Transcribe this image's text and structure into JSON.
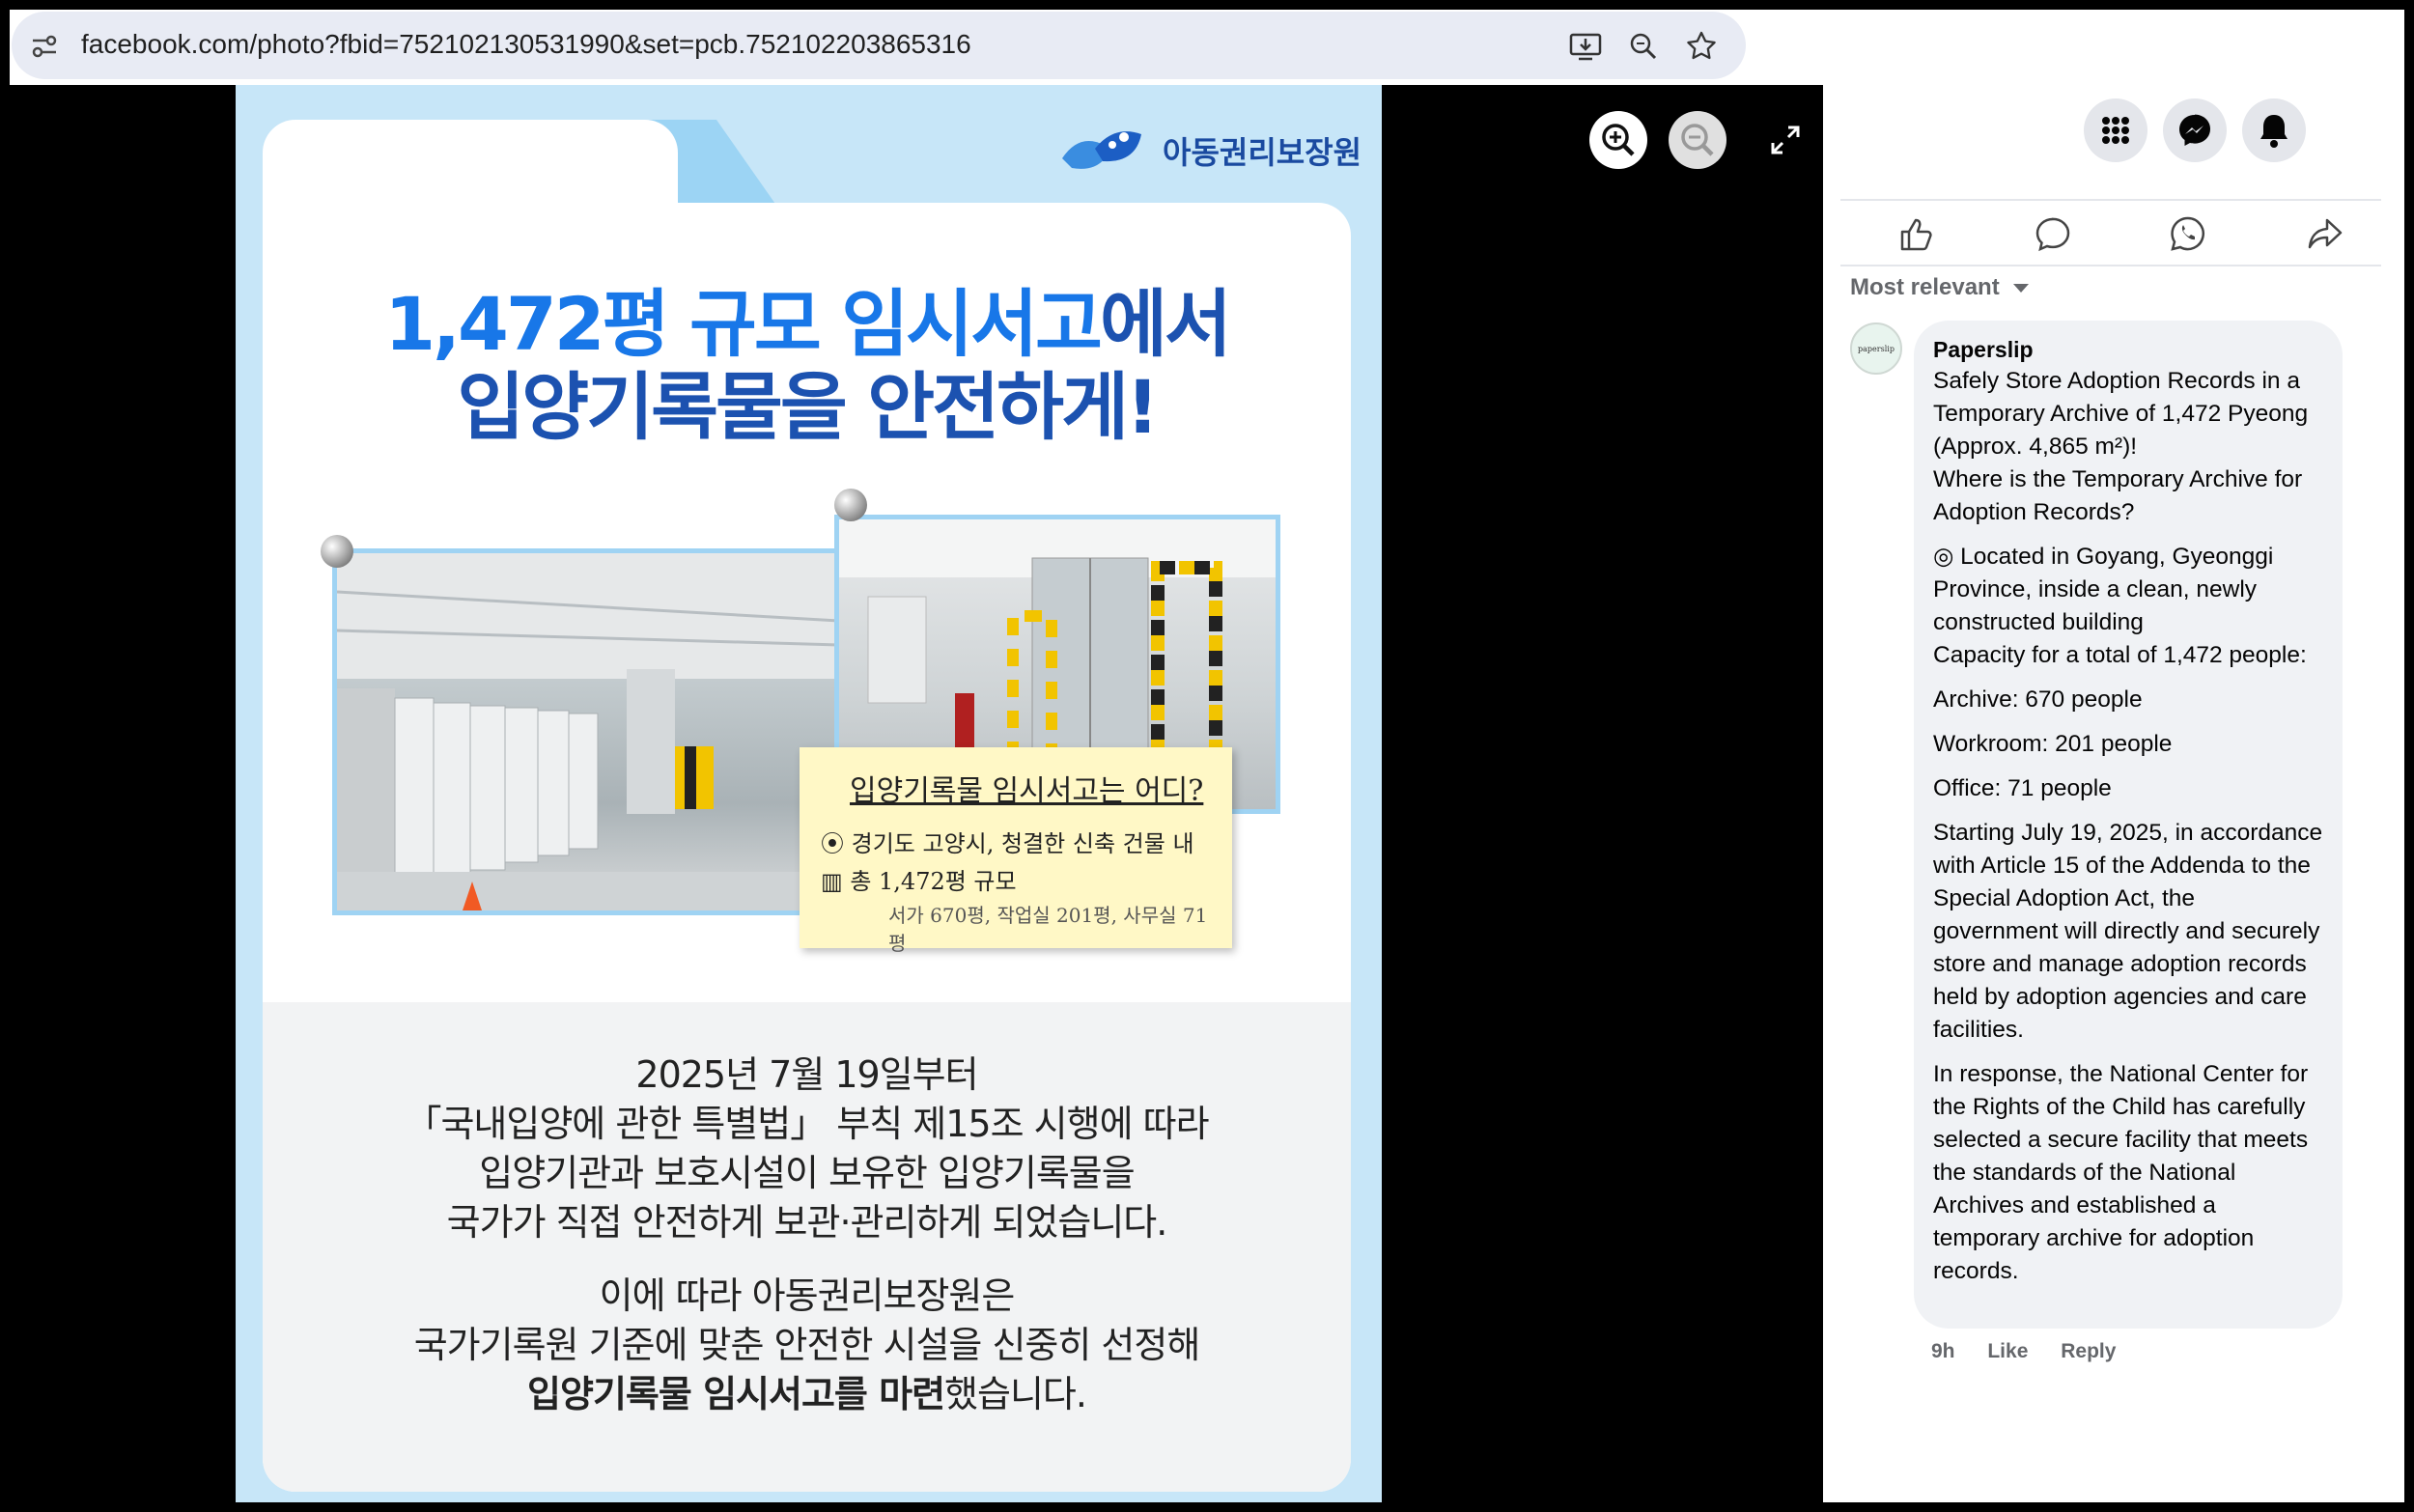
{
  "browser": {
    "url": "facebook.com/photo?fbid=752102130531990&set=pcb.752102203865316",
    "icons": [
      "tune-icon",
      "install-app-icon",
      "zoom-icon",
      "bookmark-star-icon"
    ]
  },
  "photo": {
    "logo_text": "아동권리보장원",
    "headline_line1_blue": "1,472평 규모 임시서고",
    "headline_line1_rest": "에서",
    "headline_line2": "입양기록물을 안전하게!",
    "note": {
      "title": "입양기록물 임시서고는 어디?",
      "line1": "경기도 고양시, 청결한 신축 건물 내",
      "line2": "총 1,472평 규모",
      "line3": "서가 670평, 작업실 201평, 사무실 71평"
    },
    "body_p1": [
      "2025년 7월 19일부터",
      "「국내입양에 관한 특별법」 부칙 제15조 시행에 따라",
      "입양기관과 보호시설이 보유한 입양기록물을",
      "국가가 직접 안전하게 보관·관리하게 되었습니다."
    ],
    "body_p2_l1": "이에 따라 아동권리보장원은",
    "body_p2_l2": "국가기록원 기준에 맞춘 안전한 시설을 신중히 선정해",
    "body_p2_l3_bold": "입양기록물 임시서고를 마련",
    "body_p2_l3_rest": "했습니다."
  },
  "viewer_controls": {
    "icons": [
      "zoom-in-icon",
      "zoom-out-icon",
      "fullscreen-icon"
    ]
  },
  "panel": {
    "nav_icons": [
      "menu-grid-icon",
      "messenger-icon",
      "notifications-icon"
    ],
    "actions": [
      "like-icon",
      "comment-icon",
      "whatsapp-icon",
      "share-icon"
    ],
    "sort_label": "Most relevant",
    "comment": {
      "avatar_text": "paperslip",
      "author": "Paperslip",
      "paragraphs": [
        "Safely Store Adoption Records in a Temporary Archive of 1,472 Pyeong (Approx. 4,865 m²)!\nWhere is the Temporary Archive for Adoption Records?",
        "◎ Located in Goyang, Gyeonggi Province, inside a clean, newly constructed building\nCapacity for a total of 1,472 people:",
        "Archive: 670 people",
        "Workroom: 201 people",
        "Office: 71 people",
        "Starting July 19, 2025, in accordance with Article 15 of the Addenda to the Special Adoption Act, the government will directly and securely store and manage adoption records held by adoption agencies and care facilities.",
        "In response, the National Center for the Rights of the Child has carefully selected a secure facility that meets the standards of the National Archives and established a temporary archive for adoption records."
      ],
      "time": "9h",
      "like_label": "Like",
      "reply_label": "Reply"
    }
  }
}
